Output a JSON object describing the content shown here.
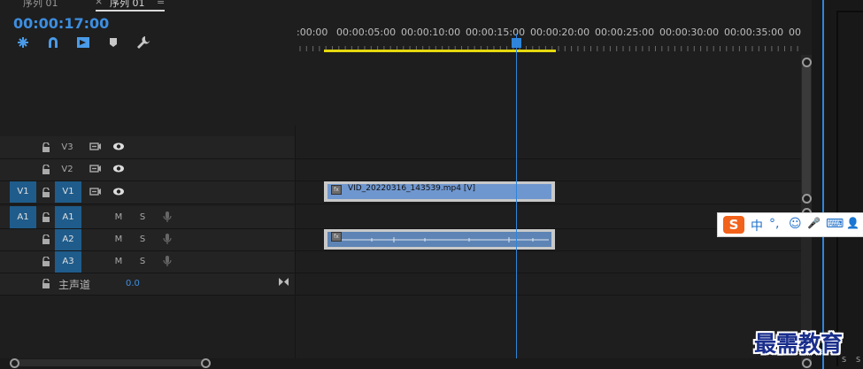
{
  "tabs": [
    {
      "label": "序列 01"
    },
    {
      "label": "序列 01",
      "active": true
    }
  ],
  "tab_close": "×",
  "tab_menu": "≡",
  "timecode": "00:00:17:00",
  "tools": [
    {
      "icon": "snap-icon"
    },
    {
      "icon": "linked-selection-icon"
    },
    {
      "icon": "insert-sequence-icon"
    },
    {
      "icon": "add-marker-icon"
    },
    {
      "icon": "wrench-icon"
    }
  ],
  "ruler": {
    "labels": [
      ":00:00",
      "00:00:05:00",
      "00:00:10:00",
      "00:00:15:00",
      "00:00:20:00",
      "00:00:25:00",
      "00:00:30:00",
      "00:00:35:00",
      "00"
    ],
    "playhead_time": "00:00:17:00"
  },
  "tracks": {
    "video": [
      {
        "name": "V3",
        "source_patch": "",
        "toggle": "camera-icon",
        "eye": "eye-icon"
      },
      {
        "name": "V2",
        "source_patch": "",
        "toggle": "camera-icon",
        "eye": "eye-icon"
      },
      {
        "name": "V1",
        "source_patch": "V1",
        "toggle": "camera-icon",
        "eye": "eye-icon"
      }
    ],
    "audio": [
      {
        "name": "A1",
        "source_patch": "A1",
        "mute": "M",
        "solo": "S"
      },
      {
        "name": "A2",
        "source_patch": "",
        "mute": "M",
        "solo": "S"
      },
      {
        "name": "A3",
        "source_patch": "",
        "mute": "M",
        "solo": "S"
      }
    ],
    "master": {
      "label": "主声道",
      "value": "0.0"
    }
  },
  "clips": {
    "video_clip": {
      "fx": "fx",
      "name": "VID_20220316_143539.mp4 [V]"
    },
    "audio_clip": {
      "fx": "fx"
    }
  },
  "ime": {
    "logo": "S",
    "items": [
      "中",
      "°,",
      "☺",
      "🎤",
      "⌨",
      "👤"
    ]
  },
  "watermark": "最需教育",
  "right_panel": {
    "labels": [
      "S",
      "S"
    ]
  },
  "colors": {
    "accent": "#2f85db",
    "work_area": "#e5d80e",
    "video_clip": "#6f97cf",
    "audio_clip": "#5d84b5"
  }
}
